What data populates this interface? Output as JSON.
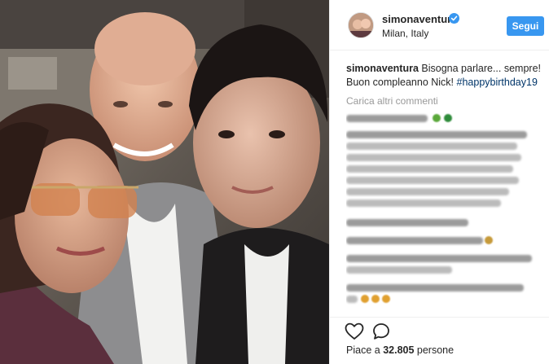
{
  "post": {
    "author": {
      "username": "simonaventura",
      "verified": true,
      "location": "Milan, Italy",
      "follow_label": "Segui"
    },
    "caption": {
      "username": "simonaventura",
      "text": "Bisogna parlare... sempre! Buon compleanno Nick!",
      "hashtag": "#happybirthday19"
    },
    "load_more_label": "Carica altri commenti",
    "likes": {
      "prefix": "Piace a",
      "count": "32.805",
      "suffix": "persone"
    },
    "icons": {
      "like": "heart-icon",
      "comment": "comment-bubble-icon",
      "verified": "verified-badge-icon"
    },
    "colors": {
      "follow_button": "#3897f0",
      "hashtag": "#003569",
      "muted": "#999999",
      "text": "#262626"
    }
  }
}
